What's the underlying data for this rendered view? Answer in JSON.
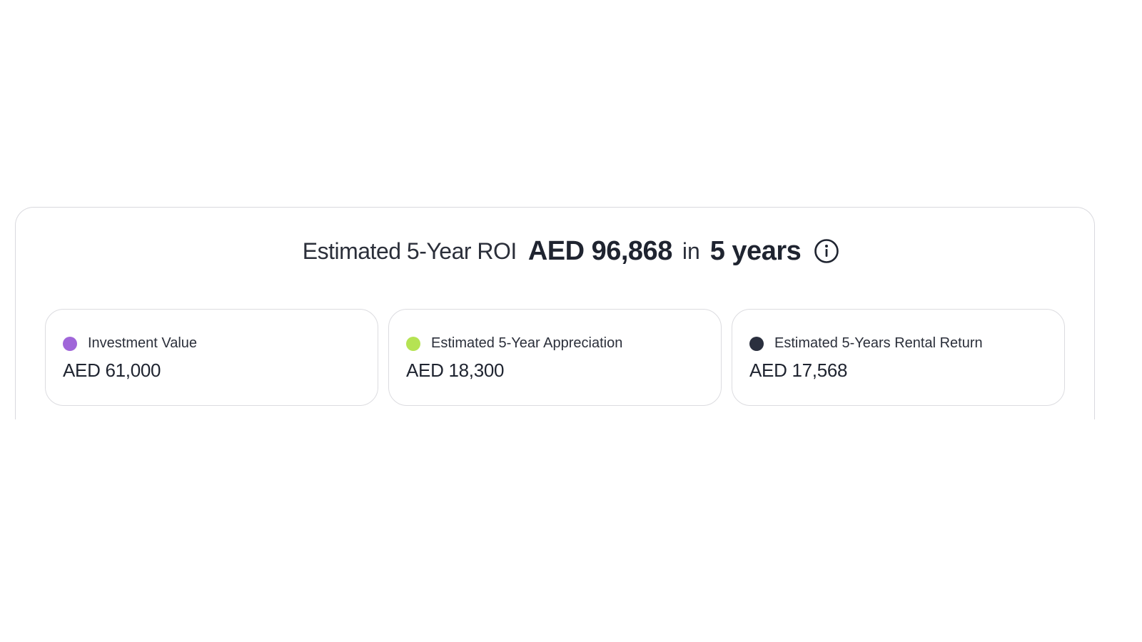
{
  "roi": {
    "label": "Estimated 5-Year ROI",
    "amount": "AED 96,868",
    "connector": "in",
    "period": "5 years",
    "info_icon": "info-circle-icon"
  },
  "cards": [
    {
      "label": "Investment Value",
      "value": "AED 61,000",
      "dot_color": "#a066d9"
    },
    {
      "label": "Estimated 5-Year Appreciation",
      "value": "AED 18,300",
      "dot_color": "#b5e353"
    },
    {
      "label": "Estimated 5-Years Rental Return",
      "value": "AED 17,568",
      "dot_color": "#2a2f3e"
    }
  ]
}
